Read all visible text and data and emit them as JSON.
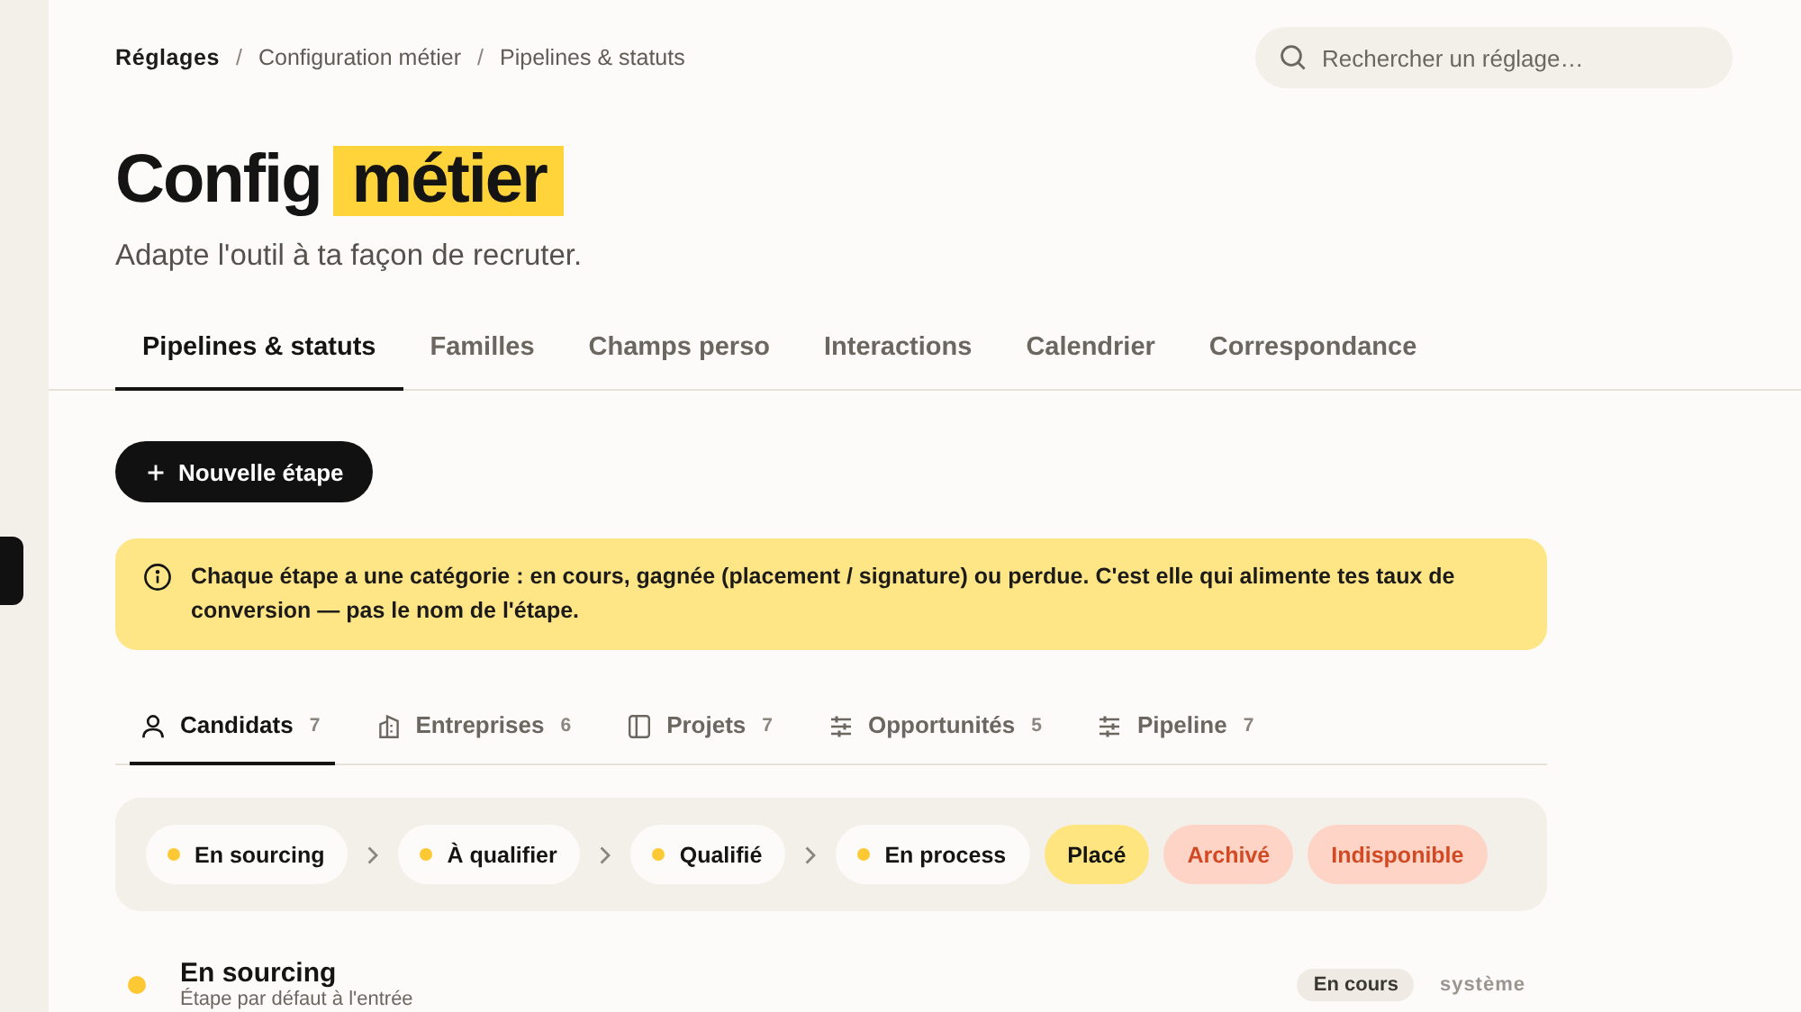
{
  "breadcrumb": [
    {
      "kind": "root",
      "text": "Réglages"
    },
    {
      "kind": "separator",
      "text": "/"
    },
    {
      "kind": "link",
      "text": "Configuration métier"
    },
    {
      "kind": "separator",
      "text": "/"
    },
    {
      "kind": "link",
      "text": "Pipelines & statuts"
    }
  ],
  "search": {
    "placeholder": "Rechercher un réglage…"
  },
  "header": {
    "title": "Config",
    "highlight": "métier",
    "subtitle": "Adapte l'outil à ta façon de recruter."
  },
  "tabs": [
    {
      "label": "Pipelines & statuts",
      "selected": true
    },
    {
      "label": "Familles",
      "selected": false
    },
    {
      "label": "Champs perso",
      "selected": false
    },
    {
      "label": "Interactions",
      "selected": false
    },
    {
      "label": "Calendrier",
      "selected": false
    },
    {
      "label": "Correspondance",
      "selected": false
    }
  ],
  "new_stage_button": {
    "label": "Nouvelle étape"
  },
  "notice": {
    "text": "Chaque étape a une catégorie : en cours, gagnée (placement / signature) ou perdue. C'est elle qui alimente tes taux de conversion — pas le nom de l'étape."
  },
  "entity_tabs": [
    {
      "kind": "candidate",
      "label": "Candidats",
      "count": "7",
      "selected": true
    },
    {
      "kind": "company",
      "label": "Entreprises",
      "count": "6",
      "selected": false
    },
    {
      "kind": "project",
      "label": "Projets",
      "count": "7",
      "selected": false
    },
    {
      "kind": "opportunity",
      "label": "Opportunités",
      "count": "5",
      "selected": false
    },
    {
      "kind": "pipeline",
      "label": "Pipeline",
      "count": "7",
      "selected": false
    }
  ],
  "stages": [
    {
      "kind": "ongoing",
      "label": "En sourcing"
    },
    {
      "kind": "ongoing",
      "label": "À qualifier"
    },
    {
      "kind": "ongoing",
      "label": "Qualifié"
    },
    {
      "kind": "ongoing",
      "label": "En process"
    },
    {
      "kind": "won",
      "label": "Placé"
    },
    {
      "kind": "lost",
      "label": "Archivé"
    },
    {
      "kind": "lost",
      "label": "Indisponible"
    }
  ],
  "stage_list": [
    {
      "kind": "ongoing",
      "name": "En sourcing",
      "description": "Étape par défaut à l'entrée",
      "category": "En cours",
      "tag": "système"
    }
  ]
}
